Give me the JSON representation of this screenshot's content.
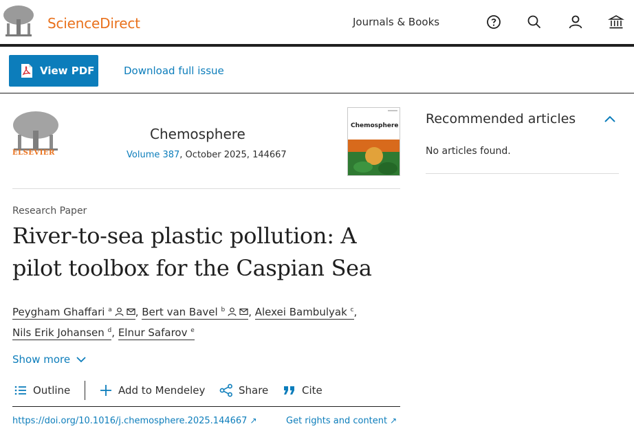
{
  "header": {
    "brand": "ScienceDirect",
    "journals_link": "Journals & Books",
    "icons": [
      "help-icon",
      "search-icon",
      "user-icon",
      "institution-icon"
    ]
  },
  "toolbar": {
    "view_pdf": "View PDF",
    "download_issue": "Download full issue"
  },
  "journal": {
    "publisher_word": "ELSEVIER",
    "name": "Chemosphere",
    "volume": "Volume 387",
    "meta_rest": ", October 2025, 144667",
    "cover_title": "Chemosphere"
  },
  "recommended": {
    "title": "Recommended articles",
    "empty": "No articles found."
  },
  "article": {
    "type": "Research Paper",
    "title": "River-to-sea plastic pollution: A pilot toolbox for the Caspian Sea",
    "authors": [
      {
        "name": "Peygham Ghaffari",
        "sup": "a"
      },
      {
        "name": "Bert van Bavel",
        "sup": "b"
      },
      {
        "name": "Alexei Bambulyak",
        "sup": "c"
      },
      {
        "name": "Nils Erik Johansen",
        "sup": "d"
      },
      {
        "name": "Elnur Safarov",
        "sup": "e"
      }
    ],
    "show_more": "Show more"
  },
  "actions": {
    "outline": "Outline",
    "mendeley": "Add to Mendeley",
    "share": "Share",
    "cite": "Cite"
  },
  "links": {
    "doi": "https://doi.org/10.1016/j.chemosphere.2025.144667",
    "rights": "Get rights and content"
  },
  "colors": {
    "accent": "#0c7dbb",
    "brand_orange": "#e9711c",
    "text": "#2e2e2e"
  }
}
